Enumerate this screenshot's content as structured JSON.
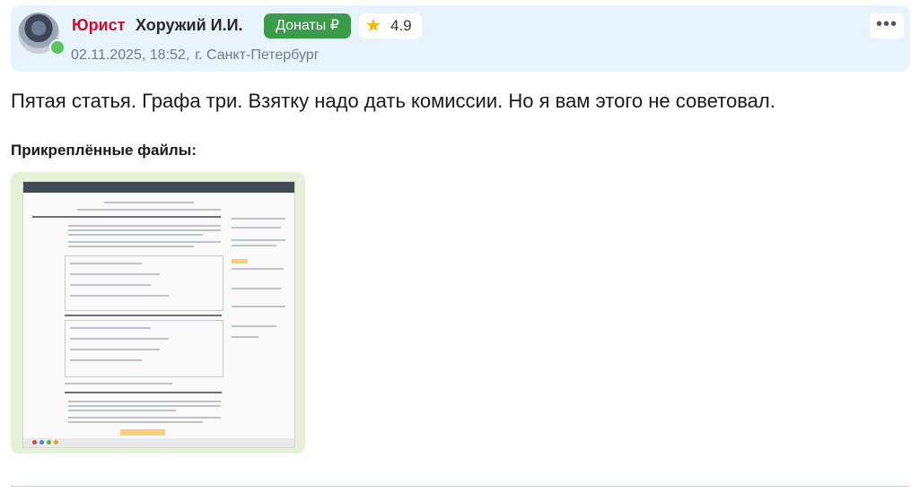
{
  "post": {
    "role": "Юрист",
    "author": "Хоружий И.И.",
    "donate_label": "Донаты ₽",
    "rating": "4.9",
    "date": "02.11.2025, 18:52,",
    "city": "г. Санкт-Петербург",
    "more_label": "•••",
    "message": "Пятая статья. Графа три. Взятку надо дать комиссии. Но я вам этого не советовал."
  },
  "attachments": {
    "title": "Прикреплённые файлы:"
  },
  "icons": {
    "star": "star-icon",
    "more": "more-dots-icon",
    "online": "online-status-icon"
  },
  "colors": {
    "header_bg": "#e8f4fd",
    "role": "#c8102e",
    "donate": "#3a9b4a",
    "star": "#f2b705",
    "attachment_bg": "#e5f2d8"
  }
}
